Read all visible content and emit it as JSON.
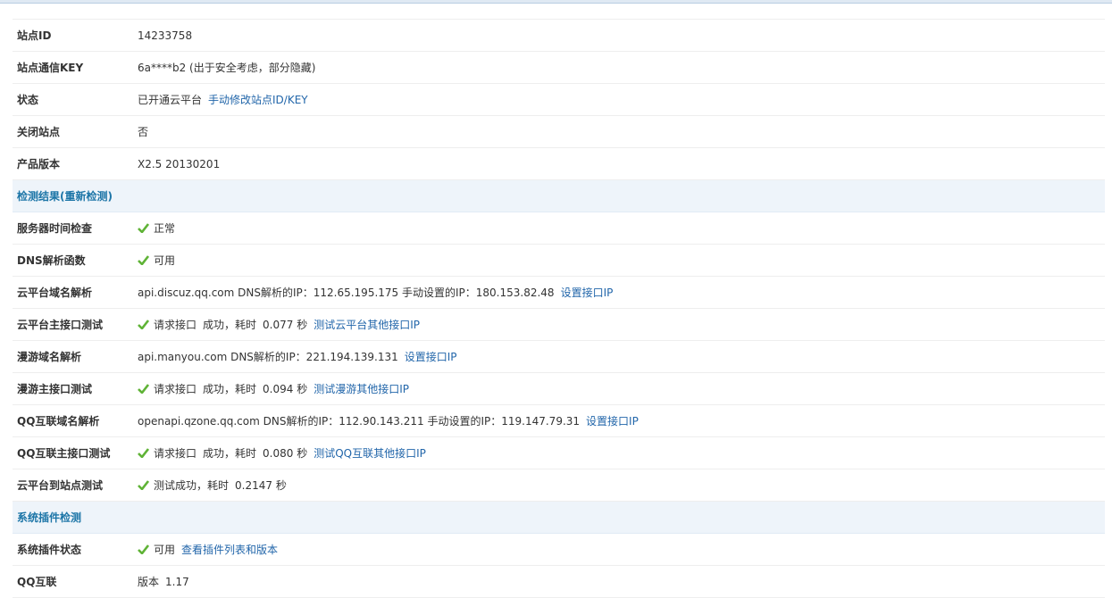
{
  "colors": {
    "link": "#2266aa",
    "section_title": "#1c75a7",
    "check": "#5fb336",
    "section_bg": "#eef4fa"
  },
  "rows": [
    {
      "label": "站点ID",
      "value": "14233758"
    },
    {
      "label": "站点通信KEY",
      "value": "6a****b2 (出于安全考虑，部分隐藏)"
    },
    {
      "label": "状态",
      "value": "已开通云平台",
      "link": "手动修改站点ID/KEY"
    },
    {
      "label": "关闭站点",
      "value": "否"
    },
    {
      "label": "产品版本",
      "value": "X2.5 20130201"
    }
  ],
  "section1": {
    "title": "检测结果(重新检测)"
  },
  "checks": [
    {
      "label": "服务器时间检查",
      "status": "正常"
    },
    {
      "label": "DNS解析函数",
      "status": "可用"
    },
    {
      "label": "云平台域名解析",
      "value": "api.discuz.qq.com DNS解析的IP：112.65.195.175 手动设置的IP：180.153.82.48",
      "link": "设置接口IP"
    },
    {
      "label": "云平台主接口测试",
      "status": "请求接口",
      "result": "成功，耗时",
      "time": "0.077 秒",
      "link": "测试云平台其他接口IP"
    },
    {
      "label": "漫游域名解析",
      "value": "api.manyou.com DNS解析的IP：221.194.139.131",
      "link": "设置接口IP"
    },
    {
      "label": "漫游主接口测试",
      "status": "请求接口",
      "result": "成功，耗时",
      "time": "0.094 秒",
      "link": "测试漫游其他接口IP"
    },
    {
      "label": "QQ互联域名解析",
      "value": "openapi.qzone.qq.com DNS解析的IP：112.90.143.211 手动设置的IP：119.147.79.31",
      "link": "设置接口IP"
    },
    {
      "label": "QQ互联主接口测试",
      "status": "请求接口",
      "result": "成功，耗时",
      "time": "0.080 秒",
      "link": "测试QQ互联其他接口IP"
    },
    {
      "label": "云平台到站点测试",
      "status": "测试成功，耗时",
      "time": "0.2147 秒"
    }
  ],
  "section2": {
    "title": "系统插件检测"
  },
  "plugins": [
    {
      "label": "系统插件状态",
      "status": "可用",
      "link": "查看插件列表和版本"
    },
    {
      "label": "QQ互联",
      "value": "版本",
      "version": "1.17"
    }
  ]
}
